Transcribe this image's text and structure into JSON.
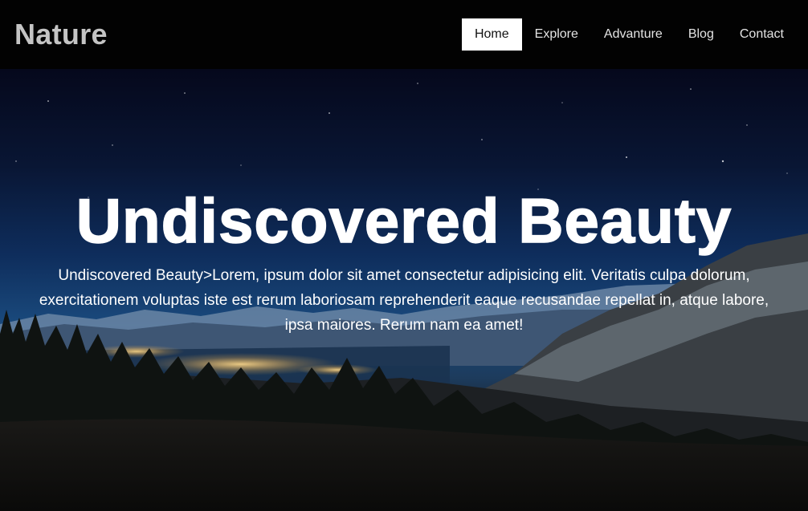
{
  "brand": {
    "name": "Nature"
  },
  "nav": {
    "items": [
      {
        "label": "Home",
        "active": true
      },
      {
        "label": "Explore"
      },
      {
        "label": "Advanture"
      },
      {
        "label": "Blog"
      },
      {
        "label": "Contact"
      }
    ]
  },
  "hero": {
    "title": "Undiscovered Beauty",
    "text": "Undiscovered Beauty>Lorem, ipsum dolor sit amet consectetur adipisicing elit. Veritatis culpa dolorum, exercitationem voluptas iste est rerum laboriosam reprehenderit eaque recusandae repellat in, atque labore, ipsa maiores. Rerum nam ea amet!"
  },
  "colors": {
    "navbar_bg": "#020202",
    "brand_text": "#c4c4c4",
    "nav_active_bg": "#ffffff",
    "hero_text": "#ffffff"
  }
}
